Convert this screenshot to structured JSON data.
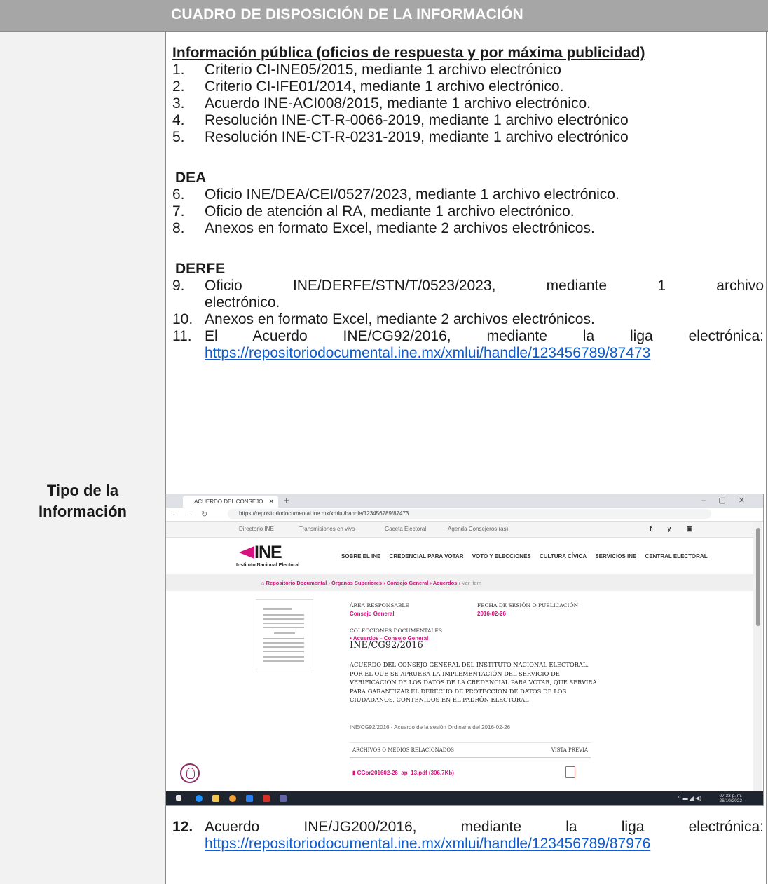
{
  "header": {
    "title": "CUADRO DE DISPOSICIÓN DE LA INFORMACIÓN"
  },
  "left": {
    "label_line1": "Tipo de la",
    "label_line2": "Información"
  },
  "content": {
    "section1_title": "Información pública (oficios de respuesta y por máxima publicidad)",
    "items_public": [
      {
        "num": "1.",
        "text": "Criterio CI-INE05/2015, mediante 1 archivo electrónico"
      },
      {
        "num": "2.",
        "text": "Criterio CI-IFE01/2014, mediante 1 archivo electrónico."
      },
      {
        "num": "3.",
        "text": "Acuerdo INE-ACI008/2015, mediante 1 archivo electrónico."
      },
      {
        "num": "4.",
        "text": "Resolución INE-CT-R-0066-2019, mediante 1 archivo electrónico"
      },
      {
        "num": "5.",
        "text": "Resolución INE-CT-R-0231-2019, mediante 1 archivo electrónico"
      }
    ],
    "section2_title": "DEA",
    "items_dea": [
      {
        "num": "6.",
        "text": "Oficio INE/DEA/CEI/0527/2023, mediante 1 archivo electrónico."
      },
      {
        "num": "7.",
        "text": "Oficio de atención al RA, mediante 1 archivo electrónico."
      },
      {
        "num": "8.",
        "text": "Anexos en formato Excel, mediante 2 archivos electrónicos."
      }
    ],
    "section3_title": "DERFE",
    "item9": {
      "num": "9.",
      "line1": "Oficio INE/DERFE/STN/T/0523/2023, mediante 1 archivo",
      "line2": "electrónico."
    },
    "item10": {
      "num": "10.",
      "text": "Anexos en formato Excel, mediante 2 archivos electrónicos."
    },
    "item11": {
      "num": "11.",
      "line1": "El Acuerdo INE/CG92/2016, mediante la liga electrónica:",
      "link": "https://repositoriodocumental.ine.mx/xmlui/handle/123456789/87473"
    },
    "item12": {
      "num": "12.",
      "line1": "Acuerdo INE/JG200/2016, mediante la liga electrónica:",
      "link": "https://repositoriodocumental.ine.mx/xmlui/handle/123456789/87976"
    }
  },
  "screenshot": {
    "tab_title": "ACUERDO DEL CONSEJO GENE",
    "url": "https://repositoriodocumental.ine.mx/xmlui/handle/123456789/87473",
    "top_links": [
      "Directorio INE",
      "Transmisiones en vivo",
      "Gaceta Electoral",
      "Agenda Consejeros (as)"
    ],
    "social": "f y ▣",
    "logo": "INE",
    "logo_sub": "Instituto Nacional Electoral",
    "menu": [
      "SOBRE EL INE",
      "CREDENCIAL PARA VOTAR",
      "VOTO Y ELECCIONES",
      "CULTURA CÍVICA",
      "SERVICIOS INE",
      "CENTRAL ELECTORAL"
    ],
    "breadcrumb": [
      "Repositorio Documental",
      "Órganos Superiores",
      "Consejo General",
      "Acuerdos"
    ],
    "breadcrumb_last": "Ver ítem",
    "area_label": "ÁREA RESPONSABLE",
    "area_value": "Consejo General",
    "fecha_label": "FECHA DE SESIÓN O PUBLICACIÓN",
    "fecha_value": "2016-02-26",
    "colecciones_label": "COLECCIONES DOCUMENTALES",
    "colecciones_value": "Acuerdos - Consejo General",
    "doc_id": "INE/CG92/2016",
    "doc_desc": "ACUERDO DEL CONSEJO GENERAL DEL INSTITUTO NACIONAL ELECTORAL, POR EL QUE SE APRUEBA LA IMPLEMENTACIÓN DEL SERVICIO DE VERIFICACIÓN DE LOS DATOS DE LA CREDENCIAL PARA VOTAR, QUE SERVIRÁ PARA GARANTIZAR EL DERECHO DE PROTECCIÓN DE DATOS DE LOS CIUDADANOS, CONTENIDOS EN EL PADRÓN ELECTORAL",
    "doc_session": "INE/CG92/2016 - Acuerdo de la sesión Ordinaria del 2016-02-26",
    "files_label": "ARCHIVOS O MEDIOS RELACIONADOS",
    "preview_label": "VISTA PREVIA",
    "file_name": "CGor201602-26_ap_13.pdf (306.7Kb)",
    "clock_time": "07:33 p. m.",
    "clock_date": "26/10/2022"
  }
}
